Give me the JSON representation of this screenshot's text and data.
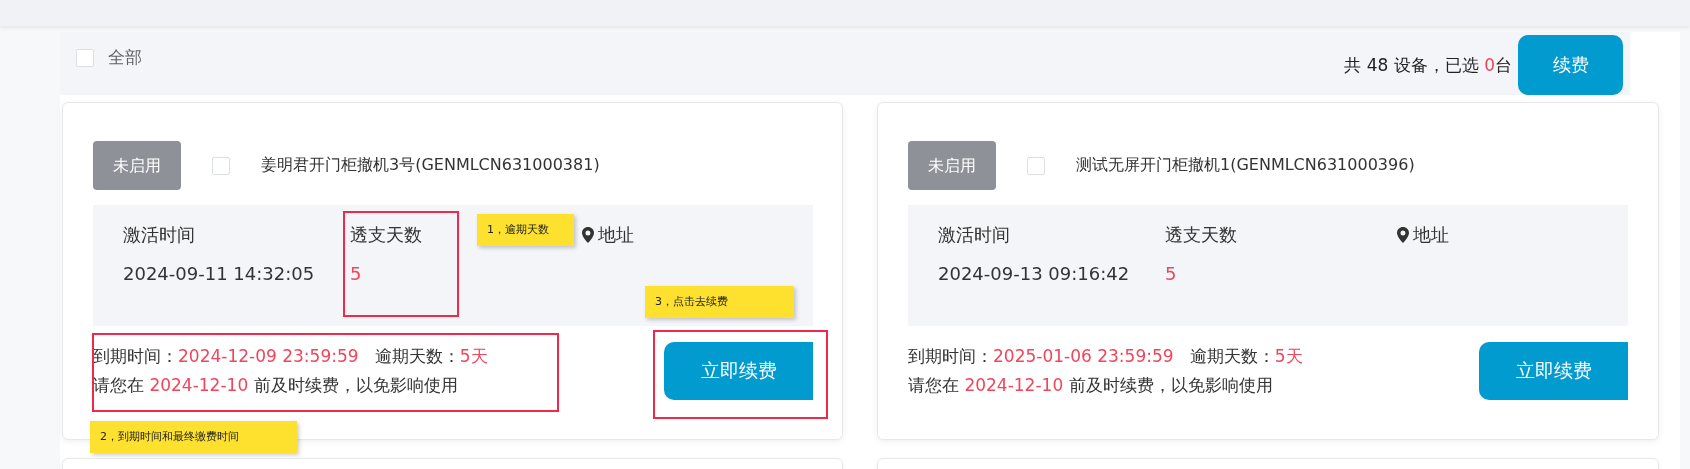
{
  "header": {
    "select_all": {
      "label": "全部",
      "checked": false
    },
    "summary": {
      "prefix": "共 48 设备，已选 ",
      "count": "0",
      "suffix": "台"
    },
    "renew_button": "续费"
  },
  "cards": [
    {
      "status": "未启用",
      "checked": false,
      "name": "姜明君开门柜撤机3号(GENMLCN631000381)",
      "activation_label": "激活时间",
      "activation_time": "2024-09-11 14:32:05",
      "overdraft_label": "透支天数",
      "overdraft_days": "5",
      "address_label": "地址",
      "expiry_label": "到期时间：",
      "expiry_time": "2024-12-09 23:59:59",
      "overdue_label": "逾期天数：",
      "overdue_days": "5天",
      "notice_prefix": "请您在 ",
      "notice_date": "2024-12-10",
      "notice_suffix": " 前及时续费，以免影响使用",
      "button": "立即续费",
      "annotations": [
        {
          "kind": "box"
        },
        {
          "kind": "box"
        },
        {
          "kind": "box"
        },
        {
          "kind": "note",
          "text": "1，逾期天数"
        },
        {
          "kind": "note",
          "text": "3，点击去续费"
        },
        {
          "kind": "note",
          "text": "2，到期时间和最终缴费时间"
        }
      ]
    },
    {
      "status": "未启用",
      "checked": false,
      "name": "测试无屏开门柜撤机1(GENMLCN631000396)",
      "activation_label": "激活时间",
      "activation_time": "2024-09-13 09:16:42",
      "overdraft_label": "透支天数",
      "overdraft_days": "5",
      "address_label": "地址",
      "expiry_label": "到期时间：",
      "expiry_time": "2025-01-06 23:59:59",
      "overdue_label": "逾期天数：",
      "overdue_days": "5天",
      "notice_prefix": "请您在 ",
      "notice_date": "2024-12-10",
      "notice_suffix": " 前及时续费，以免影响使用",
      "button": "立即续费"
    }
  ]
}
